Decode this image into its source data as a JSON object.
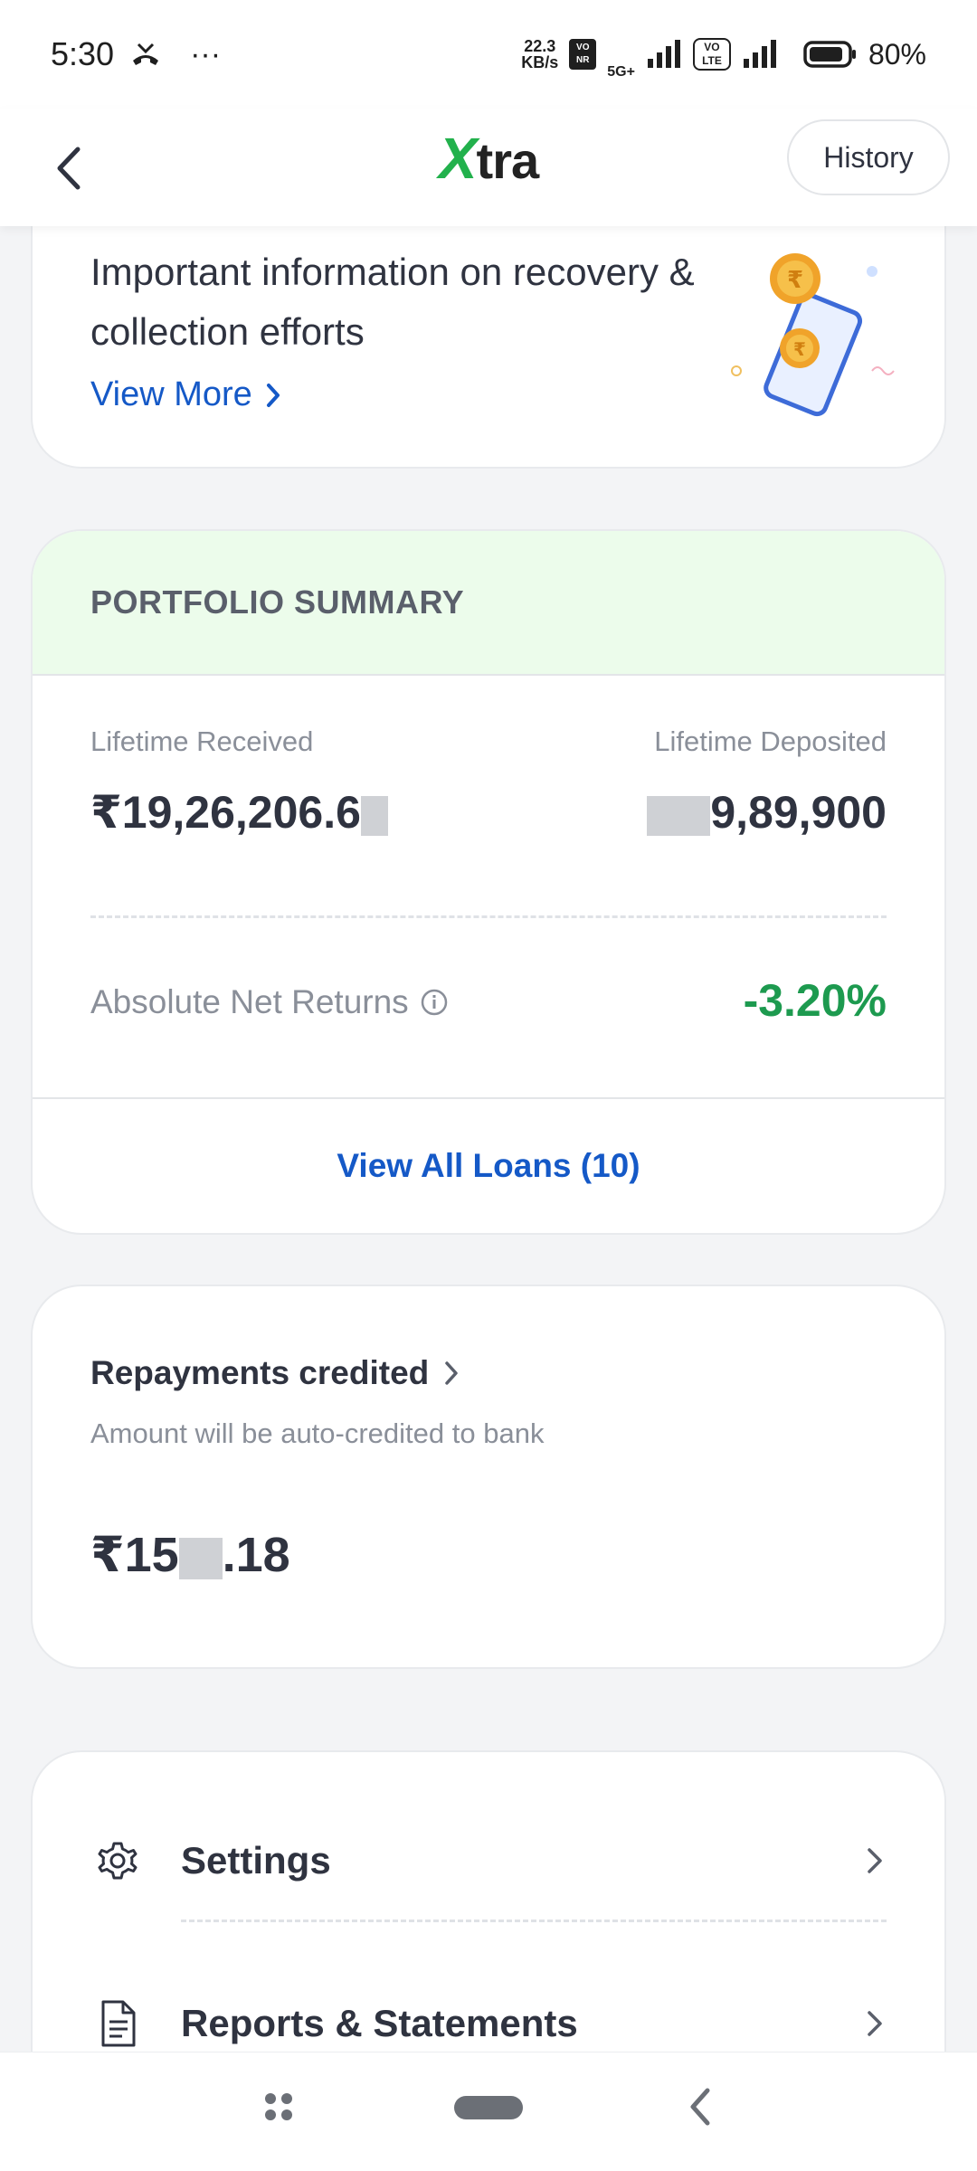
{
  "status_bar": {
    "time": "5:30",
    "overflow_dots": "···",
    "net_speed_value": "22.3",
    "net_speed_unit": "KB/s",
    "vonr_badge": "VO NR",
    "network_type": "5G+",
    "volte_badge": "VO LTE",
    "battery_percent": "80%"
  },
  "header": {
    "logo_x": "X",
    "logo_rest": "tra",
    "history_label": "History"
  },
  "info_banner": {
    "text": "Important information on recovery & collection efforts",
    "link_label": "View More"
  },
  "portfolio": {
    "heading": "PORTFOLIO SUMMARY",
    "lifetime_received_label": "Lifetime Received",
    "lifetime_received_value": "₹19,26,206.6",
    "lifetime_deposited_label": "Lifetime Deposited",
    "lifetime_deposited_value": "9,89,900",
    "net_returns_label": "Absolute Net Returns",
    "net_returns_value": "-3.20%",
    "view_all_label": "View All Loans (10)"
  },
  "repayments": {
    "title": "Repayments credited",
    "subtitle": "Amount will be auto-credited to bank",
    "amount_prefix": "₹15",
    "amount_suffix": ".18"
  },
  "menu": {
    "items": [
      {
        "label": "Settings",
        "icon": "gear-icon"
      },
      {
        "label": "Reports & Statements",
        "icon": "document-icon"
      }
    ]
  },
  "colors": {
    "brand_green": "#22b14c",
    "link_blue": "#1559c7",
    "returns_green": "#1d9a4f",
    "summary_header_bg": "#ecfceb"
  }
}
